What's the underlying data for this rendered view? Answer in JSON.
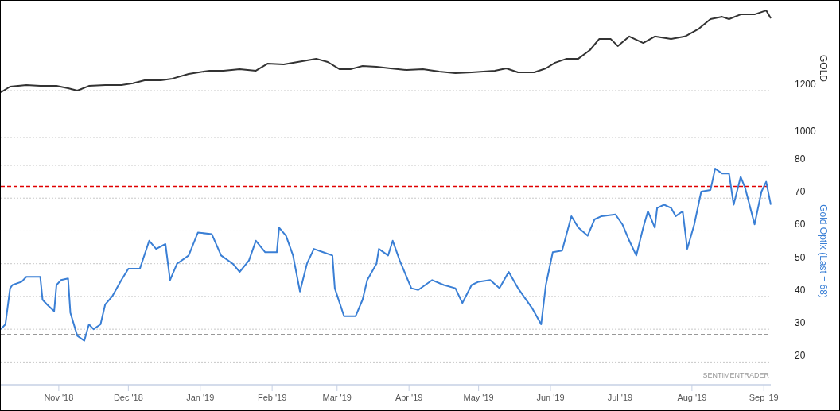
{
  "charts": [
    {
      "chart_data": {
        "type": "line",
        "ylabel": "GOLD",
        "xlim": [
          "2018-10-07",
          "2019-09-04"
        ],
        "ylim": [
          1000,
          1583
        ],
        "grid": true,
        "yticks": [
          1000,
          1200
        ],
        "x": [
          "2018-10-07",
          "2018-10-11",
          "2018-10-18",
          "2018-10-24",
          "2018-10-31",
          "2018-11-05",
          "2018-11-09",
          "2018-11-14",
          "2018-11-21",
          "2018-11-28",
          "2018-12-03",
          "2018-12-08",
          "2018-12-15",
          "2018-12-20",
          "2018-12-27",
          "2019-01-05",
          "2019-01-11",
          "2019-01-18",
          "2019-01-25",
          "2019-01-30",
          "2019-02-06",
          "2019-02-14",
          "2019-02-20",
          "2019-02-25",
          "2019-03-02",
          "2019-03-07",
          "2019-03-12",
          "2019-03-18",
          "2019-03-24",
          "2019-03-31",
          "2019-04-07",
          "2019-04-14",
          "2019-04-21",
          "2019-04-28",
          "2019-05-03",
          "2019-05-08",
          "2019-05-13",
          "2019-05-18",
          "2019-05-25",
          "2019-05-30",
          "2019-06-03",
          "2019-06-08",
          "2019-06-13",
          "2019-06-18",
          "2019-06-22",
          "2019-06-27",
          "2019-06-30",
          "2019-07-05",
          "2019-07-11",
          "2019-07-16",
          "2019-07-23",
          "2019-07-29",
          "2019-08-04",
          "2019-08-09",
          "2019-08-14",
          "2019-08-17",
          "2019-08-22",
          "2019-08-28",
          "2019-09-02",
          "2019-09-04"
        ],
        "series": [
          {
            "color": "#333333",
            "values": [
              1193,
              1217,
              1224,
              1220,
              1220,
              1210,
              1200,
              1220,
              1224,
              1224,
              1231,
              1244,
              1244,
              1251,
              1271,
              1285,
              1285,
              1292,
              1285,
              1315,
              1312,
              1325,
              1336,
              1322,
              1292,
              1292,
              1305,
              1302,
              1295,
              1288,
              1292,
              1281,
              1275,
              1278,
              1281,
              1285,
              1295,
              1278,
              1278,
              1295,
              1319,
              1336,
              1336,
              1373,
              1420,
              1420,
              1390,
              1431,
              1403,
              1431,
              1420,
              1431,
              1464,
              1505,
              1515,
              1505,
              1525,
              1525,
              1542,
              1508
            ]
          }
        ]
      }
    },
    {
      "credit": "SENTIMENTRADER",
      "chart_data": {
        "type": "line",
        "ylabel": "Gold Optix (Last = 68)",
        "xlim": [
          "2018-10-07",
          "2019-09-04"
        ],
        "ylim": [
          13.3,
          80
        ],
        "grid": true,
        "yticks": [
          20,
          30,
          40,
          50,
          60,
          70,
          80
        ],
        "xticks": [
          {
            "value": "2018-11-01",
            "label": "Nov '18"
          },
          {
            "value": "2018-12-01",
            "label": "Dec '18"
          },
          {
            "value": "2019-01-01",
            "label": "Jan '19"
          },
          {
            "value": "2019-02-01",
            "label": "Feb '19"
          },
          {
            "value": "2019-03-01",
            "label": "Mar '19"
          },
          {
            "value": "2019-04-01",
            "label": "Apr '19"
          },
          {
            "value": "2019-05-01",
            "label": "May '19"
          },
          {
            "value": "2019-06-01",
            "label": "Jun '19"
          },
          {
            "value": "2019-07-01",
            "label": "Jul '19"
          },
          {
            "value": "2019-08-01",
            "label": "Aug '19"
          },
          {
            "value": "2019-09-01",
            "label": "Sep '19"
          }
        ],
        "x": [
          "2018-10-07",
          "2018-10-09",
          "2018-10-11",
          "2018-10-12",
          "2018-10-16",
          "2018-10-18",
          "2018-10-21",
          "2018-10-24",
          "2018-10-25",
          "2018-10-27",
          "2018-10-30",
          "2018-10-31",
          "2018-11-02",
          "2018-11-05",
          "2018-11-06",
          "2018-11-09",
          "2018-11-12",
          "2018-11-14",
          "2018-11-16",
          "2018-11-19",
          "2018-11-21",
          "2018-11-24",
          "2018-11-28",
          "2018-12-01",
          "2018-12-06",
          "2018-12-10",
          "2018-12-13",
          "2018-12-17",
          "2018-12-19",
          "2018-12-22",
          "2018-12-27",
          "2018-12-31",
          "2019-01-06",
          "2019-01-10",
          "2019-01-15",
          "2019-01-18",
          "2019-01-22",
          "2019-01-25",
          "2019-01-29",
          "2019-02-03",
          "2019-02-04",
          "2019-02-07",
          "2019-02-10",
          "2019-02-13",
          "2019-02-16",
          "2019-02-19",
          "2019-02-23",
          "2019-02-27",
          "2019-02-28",
          "2019-03-04",
          "2019-03-09",
          "2019-03-12",
          "2019-03-14",
          "2019-03-18",
          "2019-03-19",
          "2019-03-23",
          "2019-03-25",
          "2019-03-28",
          "2019-04-02",
          "2019-04-05",
          "2019-04-11",
          "2019-04-16",
          "2019-04-21",
          "2019-04-24",
          "2019-04-28",
          "2019-05-01",
          "2019-05-06",
          "2019-05-10",
          "2019-05-14",
          "2019-05-18",
          "2019-05-24",
          "2019-05-28",
          "2019-05-30",
          "2019-06-02",
          "2019-06-06",
          "2019-06-10",
          "2019-06-13",
          "2019-06-17",
          "2019-06-20",
          "2019-06-23",
          "2019-06-29",
          "2019-07-02",
          "2019-07-05",
          "2019-07-08",
          "2019-07-11",
          "2019-07-13",
          "2019-07-16",
          "2019-07-17",
          "2019-07-20",
          "2019-07-23",
          "2019-07-25",
          "2019-07-28",
          "2019-07-30",
          "2019-08-02",
          "2019-08-05",
          "2019-08-09",
          "2019-08-11",
          "2019-08-14",
          "2019-08-17",
          "2019-08-19",
          "2019-08-22",
          "2019-08-24",
          "2019-08-28",
          "2019-08-31",
          "2019-09-02",
          "2019-09-04"
        ],
        "series": [
          {
            "color": "#3a7fd5",
            "values": [
              30,
              31.5,
              42.5,
              43.5,
              44.5,
              46,
              46,
              46,
              39,
              37.5,
              35.5,
              43.5,
              45,
              45.5,
              35,
              28,
              26.5,
              31.5,
              30,
              31.5,
              37.5,
              40,
              45,
              48.5,
              48.5,
              57,
              54.5,
              56,
              45,
              50,
              52.5,
              59.5,
              59,
              52.5,
              50,
              47.5,
              51,
              57,
              53.5,
              53.5,
              61,
              58.5,
              52.5,
              41.5,
              50,
              54.5,
              53.5,
              52.5,
              42.5,
              34,
              34,
              39,
              45,
              50,
              54.5,
              52.5,
              57,
              51,
              42.5,
              42,
              45,
              43.5,
              42.5,
              38,
              43.5,
              44.5,
              45,
              42.5,
              47.5,
              42.5,
              36.5,
              31.5,
              43.5,
              53.5,
              54,
              64.5,
              61,
              58.5,
              63.5,
              64.5,
              65,
              62,
              57,
              52.5,
              61,
              66,
              61,
              67,
              68,
              67,
              64.5,
              66,
              54.5,
              62,
              72,
              72.5,
              79,
              77.5,
              77.5,
              68,
              76.5,
              73,
              62,
              72,
              75,
              68
            ]
          }
        ],
        "ref_lines": [
          {
            "axis": "y",
            "value": 73.6,
            "color": "#e00000"
          },
          {
            "axis": "y",
            "value": 28.3,
            "color": "#333333"
          }
        ]
      }
    }
  ]
}
